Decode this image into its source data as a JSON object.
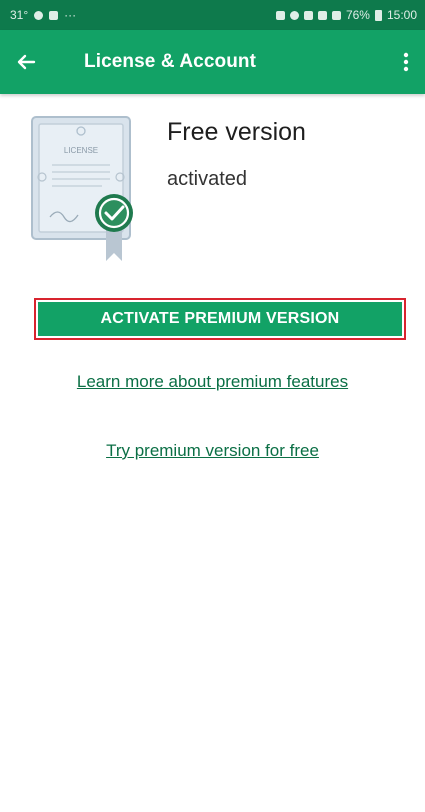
{
  "status_bar": {
    "left_text": "31°",
    "right_text": "76%",
    "time": "15:00"
  },
  "app_bar": {
    "title": "License & Account",
    "back_icon": "arrow-left-icon",
    "menu_icon": "more-vertical-icon",
    "color": "#12a266"
  },
  "license": {
    "image_text": "LICENSE",
    "title": "Free version",
    "status": "activated",
    "badge_icon": "checkmark-icon"
  },
  "actions": {
    "activate_label": "ACTIVATE PREMIUM VERSION",
    "learn_more_label": "Learn more about premium features",
    "try_label": "Try premium version for free",
    "highlight_color": "#d8242e"
  }
}
